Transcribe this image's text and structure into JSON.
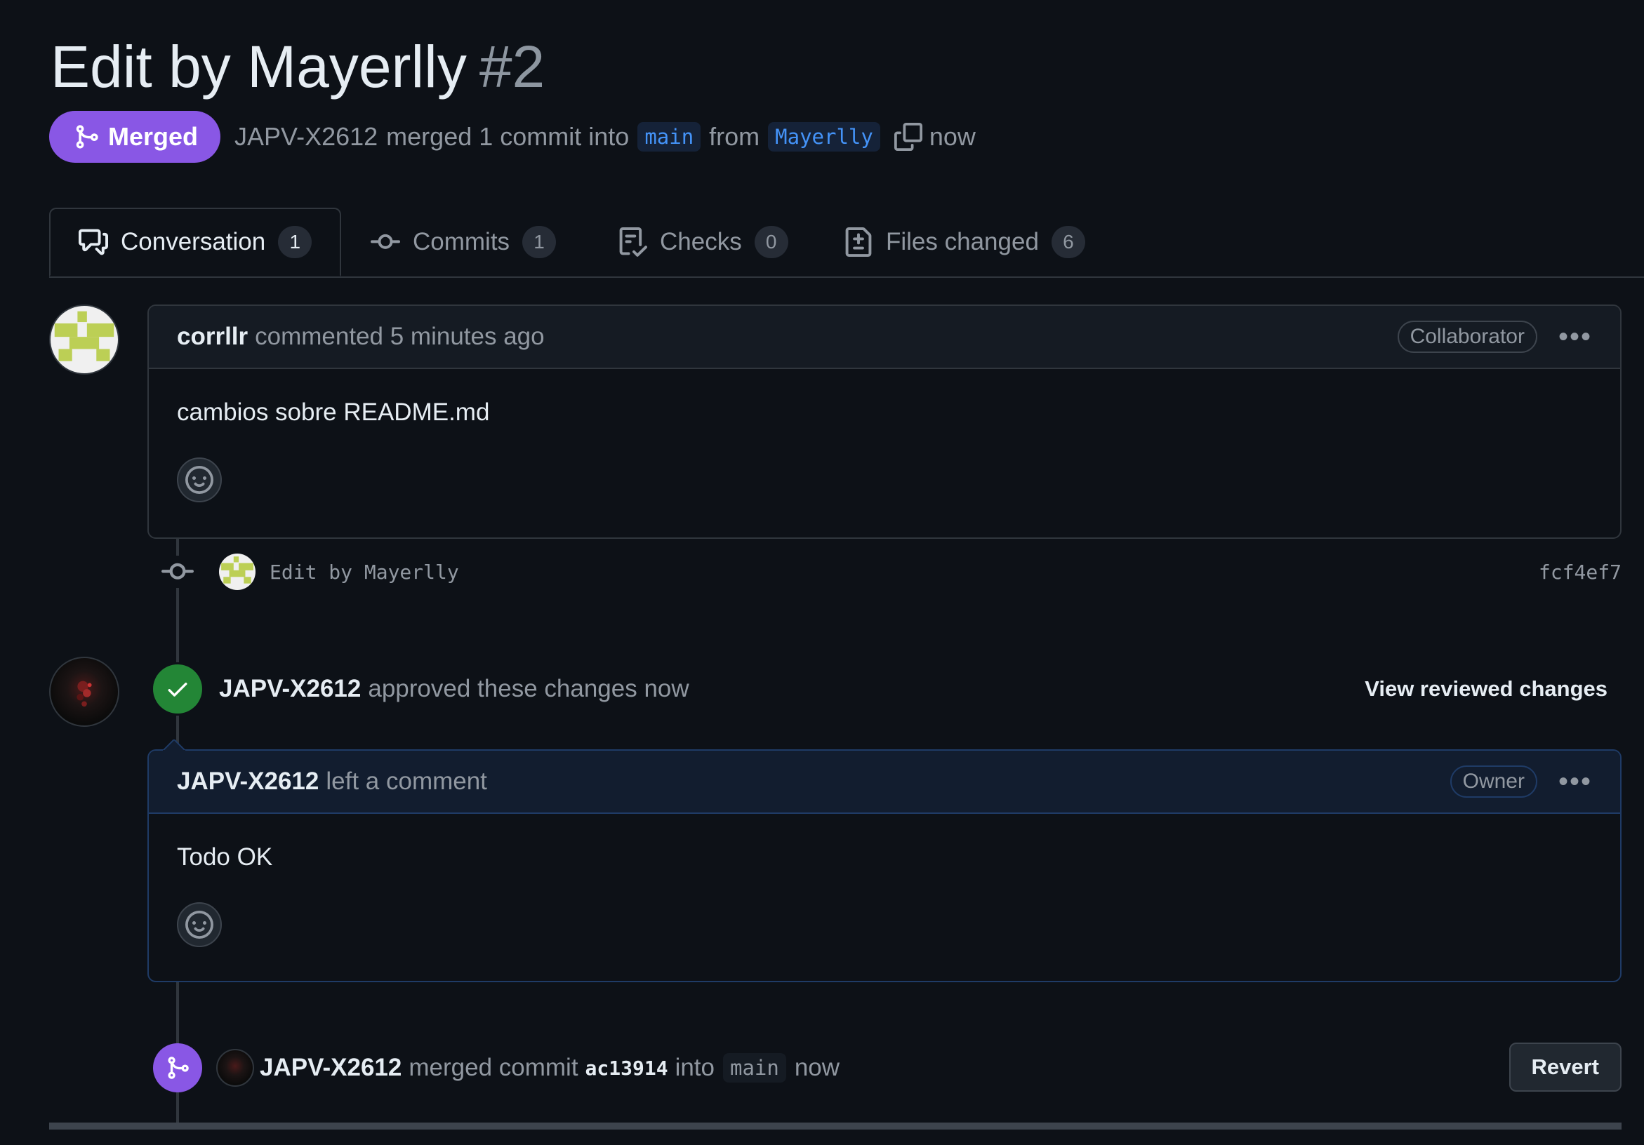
{
  "pr": {
    "title": "Edit by Mayerlly",
    "number": "#2",
    "state": "Merged",
    "author": "JAPV-X2612",
    "action": "merged 1 commit into",
    "base_branch": "main",
    "from_word": "from",
    "head_branch": "Mayerlly",
    "time": "now"
  },
  "tabs": [
    {
      "label": "Conversation",
      "count": "1"
    },
    {
      "label": "Commits",
      "count": "1"
    },
    {
      "label": "Checks",
      "count": "0"
    },
    {
      "label": "Files changed",
      "count": "6"
    }
  ],
  "comment1": {
    "user": "corrllr",
    "meta": "commented 5 minutes ago",
    "role": "Collaborator",
    "body": "cambios sobre README.md"
  },
  "commit": {
    "message": "Edit by Mayerlly",
    "sha": "fcf4ef7"
  },
  "review": {
    "user": "JAPV-X2612",
    "text": "approved these changes now",
    "link": "View reviewed changes"
  },
  "comment2": {
    "user": "JAPV-X2612",
    "meta": "left a comment",
    "role": "Owner",
    "body": "Todo OK"
  },
  "merge_event": {
    "user": "JAPV-X2612",
    "text1": "merged commit",
    "sha": "ac13914",
    "text2": "into",
    "branch": "main",
    "time": "now",
    "button": "Revert"
  },
  "colors": {
    "merged": "#8957e5",
    "approved": "#238636",
    "background": "#0d1117",
    "link": "#4493f8"
  }
}
